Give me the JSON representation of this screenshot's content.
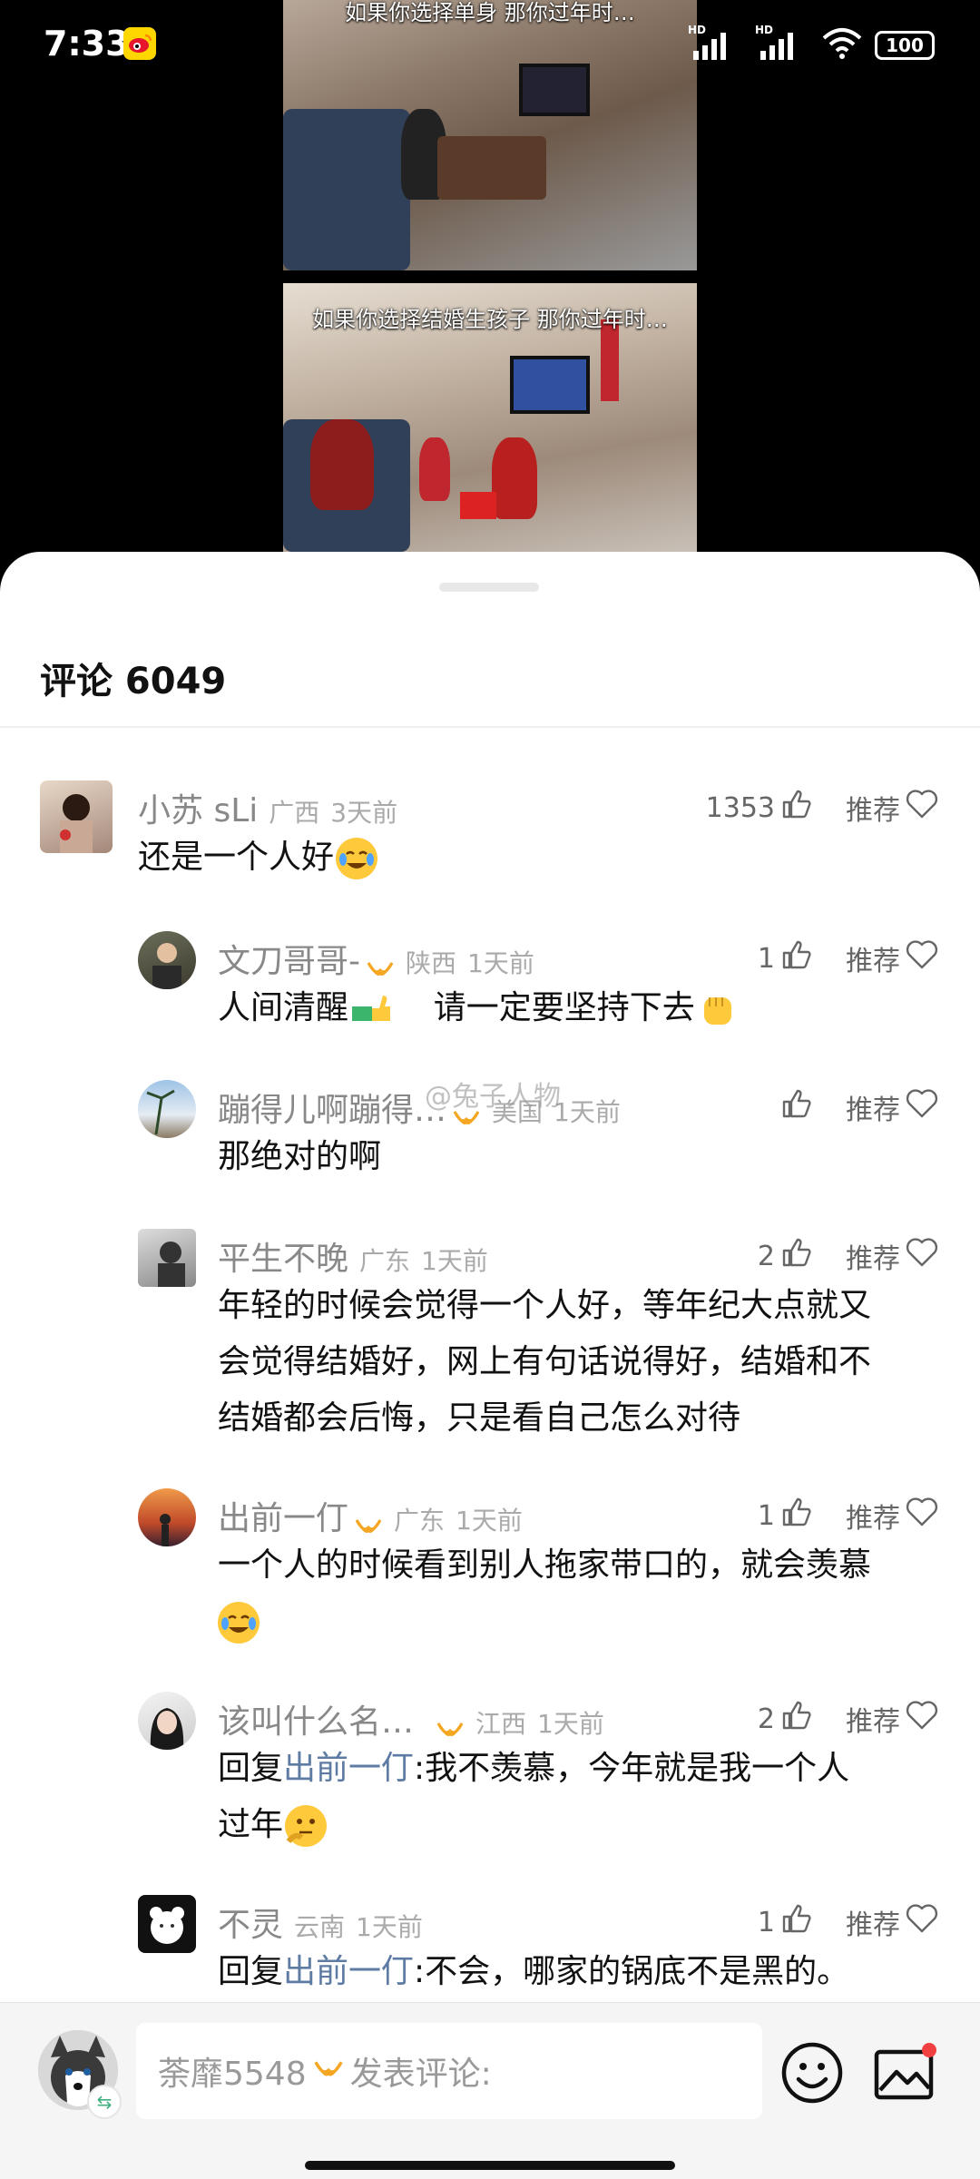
{
  "status_bar": {
    "time": "7:33",
    "battery": "100",
    "hd1": "HD",
    "hd2": "HD"
  },
  "video": {
    "caption_top": "如果你选择单身 那你过年时…",
    "caption_bottom": "如果你选择结婚生孩子 那你过年时…"
  },
  "sheet": {
    "title": "评论 6049"
  },
  "comments": [
    {
      "user": "小苏 sLi",
      "location": "广西",
      "time": "3天前",
      "likes": "1353",
      "recommend": "推荐",
      "text": "还是一个人好",
      "vip": false,
      "level": "top"
    },
    {
      "user": "文刀哥哥-",
      "location": "陕西",
      "time": "1天前",
      "likes": "1",
      "recommend": "推荐",
      "text_a": "人间清醒",
      "text_b": "请一定要坚持下去",
      "vip": true,
      "level": "sub"
    },
    {
      "user": "蹦得儿啊蹦得…",
      "location": "美国",
      "time": "1天前",
      "likes": "",
      "recommend": "推荐",
      "text": "那绝对的啊",
      "vip": true,
      "level": "sub"
    },
    {
      "user": "平生不晚",
      "location": "广东",
      "time": "1天前",
      "likes": "2",
      "recommend": "推荐",
      "line1": "年轻的时候会觉得一个人好，等年纪大点就又",
      "line2": "会觉得结婚好，网上有句话说得好，结婚和不",
      "line3": "结婚都会后悔，只是看自己怎么对待",
      "vip": false,
      "level": "sub"
    },
    {
      "user": "出前一仃",
      "location": "广东",
      "time": "1天前",
      "likes": "1",
      "recommend": "推荐",
      "line1": "一个人的时候看到别人拖家带口的，就会羡慕",
      "vip": true,
      "level": "sub"
    },
    {
      "user": "该叫什么名…",
      "location": "江西",
      "time": "1天前",
      "likes": "2",
      "recommend": "推荐",
      "reply_prefix": "回复",
      "reply_to": "出前一仃",
      "line1": ":我不羡慕，今年就是我一个人",
      "line2": "过年",
      "vip": true,
      "level": "sub"
    },
    {
      "user": "不灵",
      "location": "云南",
      "time": "1天前",
      "likes": "1",
      "recommend": "推荐",
      "reply_prefix": "回复",
      "reply_to": "出前一仃",
      "line1": ":不会，哪家的锅底不是黑的。",
      "vip": false,
      "level": "sub"
    }
  ],
  "watermark": "@兔子人物",
  "bottom_bar": {
    "user": "荼靡5548",
    "placeholder": "发表评论:"
  },
  "colors": {
    "accent_vip": "#f5a623",
    "reply_name": "#5d7ba3",
    "emoji": "#ffc93c",
    "notify_dot": "#f04040"
  }
}
